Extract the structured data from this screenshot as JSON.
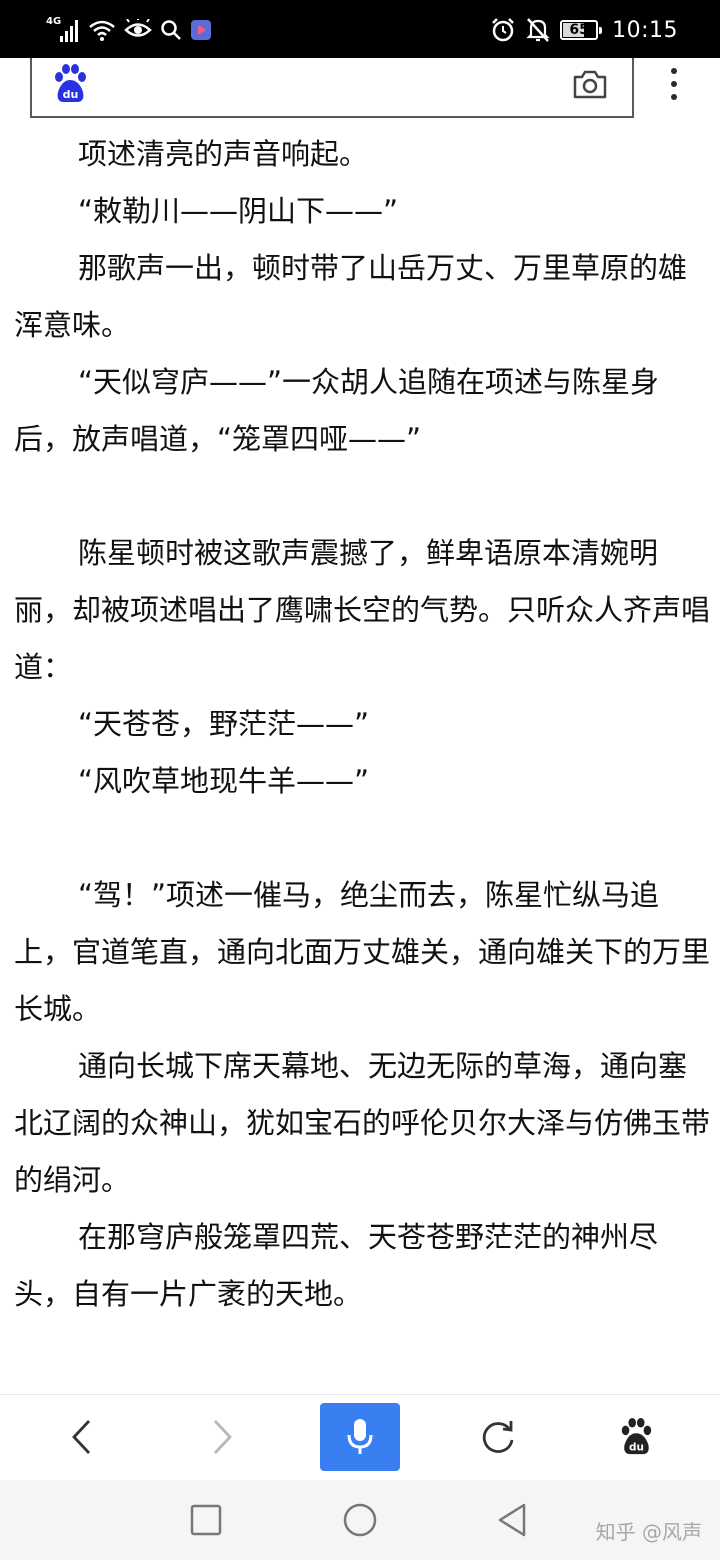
{
  "status_bar": {
    "network_label": "4G",
    "battery_level": "65",
    "battery_fraction": 0.65,
    "time": "10:15"
  },
  "article": {
    "paragraphs": [
      "项述清亮的声音响起。",
      "“敕勒川——阴山下——”",
      "那歌声一出，顿时带了山岳万丈、万里草原的雄浑意味。",
      "“天似穹庐——”一众胡人追随在项述与陈星身后，放声唱道，“笼罩四哑——”",
      "陈星顿时被这歌声震撼了，鲜卑语原本清婉明丽，却被项述唱出了鹰啸长空的气势。只听众人齐声唱道：",
      "“天苍苍，野茫茫——”",
      "“风吹草地现牛羊——”",
      "“驾！”项述一催马，绝尘而去，陈星忙纵马追上，官道笔直，通向北面万丈雄关，通向雄关下的万里长城。",
      "通向长城下席天幕地、无边无际的草海，通向塞北辽阔的众神山，犹如宝石的呼伦贝尔大泽与仿佛玉带的绢河。",
      "在那穹庐般笼罩四荒、天苍苍野茫茫的神州尽头，自有一片广袤的天地。"
    ]
  },
  "watermark": "知乎 @风声",
  "colors": {
    "status_bar_bg": "#000000",
    "voice_button": "#3a7ff2",
    "brand_blue": "#2932e1",
    "nav_bar_bg": "#f5f5f5"
  },
  "icons": {
    "search_logo": "baidu-paw-icon",
    "search_camera": "camera-icon",
    "overflow": "more-vertical-icon",
    "toolbar": [
      "back-arrow-icon",
      "forward-arrow-icon",
      "microphone-icon",
      "refresh-icon",
      "baidu-paw-icon"
    ],
    "nav": [
      "recent-apps-icon",
      "home-icon",
      "back-triangle-icon"
    ]
  }
}
